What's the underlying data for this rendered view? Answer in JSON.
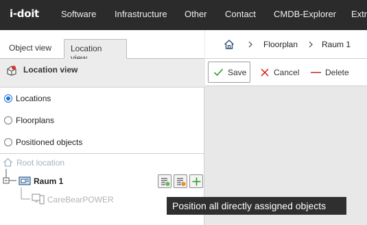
{
  "app": {
    "logo": "i-doit"
  },
  "nav": {
    "items": [
      "Software",
      "Infrastructure",
      "Other",
      "Contact",
      "CMDB-Explorer",
      "Extra"
    ]
  },
  "tabs": {
    "object_view": "Object view",
    "location_view": "Location view"
  },
  "panel": {
    "title": "Location view"
  },
  "radios": [
    {
      "label": "Locations",
      "checked": true
    },
    {
      "label": "Floorplans",
      "checked": false
    },
    {
      "label": "Positioned objects",
      "checked": false
    }
  ],
  "tree": {
    "root": "Root location",
    "room": "Raum 1",
    "child": "CareBearPOWER"
  },
  "tooltip": {
    "text": "Position all directly assigned objects"
  },
  "breadcrumb": {
    "items": [
      "Floorplan",
      "Raum 1"
    ]
  },
  "toolbar": {
    "save": "Save",
    "cancel": "Cancel",
    "delete": "Delete"
  },
  "colors": {
    "topbar": "#2b2b2b",
    "radio_checked": "#1a6fd6",
    "save_check": "#2a9d2a",
    "cancel_x": "#d11",
    "delete_dash": "#c62828",
    "add_plus": "#2a9d2a"
  }
}
